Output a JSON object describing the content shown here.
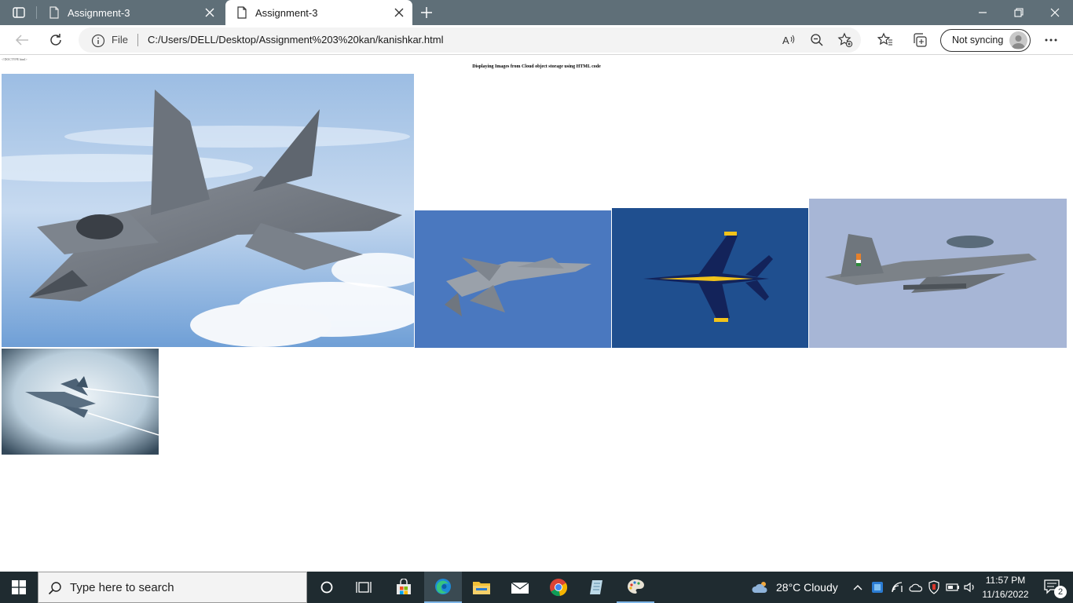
{
  "browser": {
    "tabs": [
      {
        "title": "Assignment-3",
        "active": false
      },
      {
        "title": "Assignment-3",
        "active": true
      }
    ],
    "address": {
      "scheme_label": "File",
      "url": "C:/Users/DELL/Desktop/Assignment%203%20kan/kanishkar.html"
    },
    "profile_label": "Not syncing"
  },
  "page": {
    "doctype_text": "<!DOCTYPE html>",
    "heading": "Displaying Images from Cloud object storage using HTML code",
    "images": [
      {
        "name": "f22-raptor-over-clouds",
        "sky": "#a9c6e6"
      },
      {
        "name": "f22-blue-sky",
        "sky": "#4a78bf"
      },
      {
        "name": "blue-angels-hornet",
        "sky": "#1f4f8f"
      },
      {
        "name": "tejas-trainer",
        "sky": "#a7b6d6"
      },
      {
        "name": "f15-misty",
        "sky": "#cfdfe8"
      }
    ]
  },
  "taskbar": {
    "search_placeholder": "Type here to search",
    "weather": "28°C  Cloudy",
    "time": "11:57 PM",
    "date": "11/16/2022",
    "notification_count": "2"
  },
  "colors": {
    "tabstrip": "#5f6f78",
    "taskbar": "#1f2b30"
  }
}
